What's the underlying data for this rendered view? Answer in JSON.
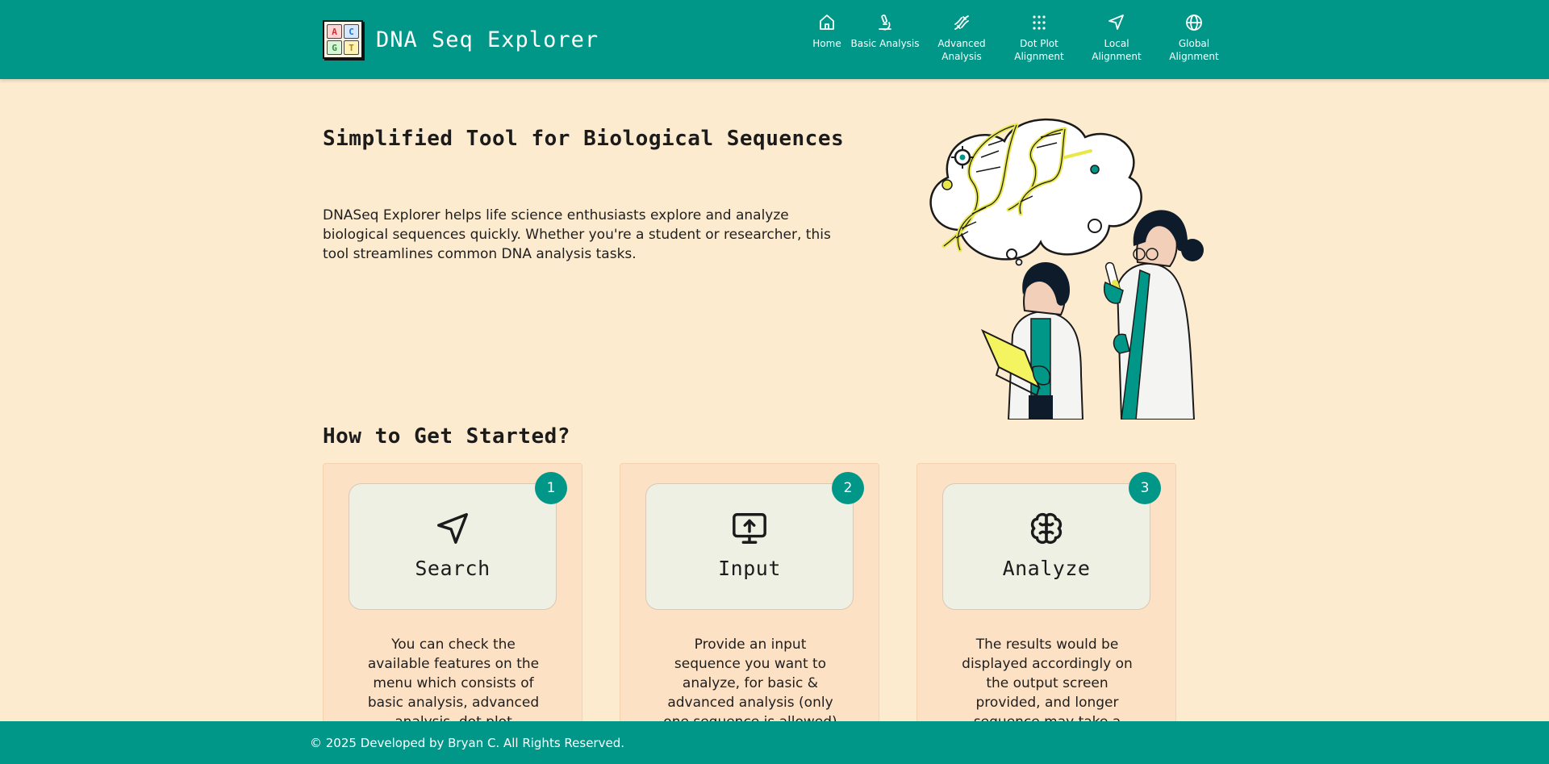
{
  "brand": {
    "title": "DNA Seq Explorer",
    "logo_letters": [
      "A",
      "C",
      "G",
      "T"
    ],
    "logo_colors": [
      "#d32f2f",
      "#1976d2",
      "#388e3c",
      "#f9a825"
    ]
  },
  "nav": {
    "items": [
      {
        "label": "Home",
        "icon": "home-icon"
      },
      {
        "label": "Basic Analysis",
        "icon": "microscope-icon"
      },
      {
        "label": "Advanced\nAnalysis",
        "icon": "dna-icon"
      },
      {
        "label": "Dot Plot\nAlignment",
        "icon": "dot-grid-icon"
      },
      {
        "label": "Local\nAlignment",
        "icon": "navigation-icon"
      },
      {
        "label": "Global\nAlignment",
        "icon": "globe-icon"
      }
    ]
  },
  "hero": {
    "title": "Simplified Tool for Biological Sequences",
    "text": "DNASeq Explorer helps life science enthusiasts explore and analyze biological sequences quickly. Whether you're a student or researcher, this tool streamlines common DNA analysis tasks."
  },
  "getting_started": {
    "title": "How to Get Started?",
    "cards": [
      {
        "number": "1",
        "title": "Search",
        "icon": "navigation-icon",
        "text": "You can check the available features on the menu which consists of basic analysis, advanced analysis, dot plot"
      },
      {
        "number": "2",
        "title": "Input",
        "icon": "upload-monitor-icon",
        "text": "Provide an input sequence you want to analyze, for basic & advanced analysis (only one sequence is allowed) the other features"
      },
      {
        "number": "3",
        "title": "Analyze",
        "icon": "brain-icon",
        "text": "The results would be displayed accordingly on the output screen provided, and longer sequence may take a longer time to"
      }
    ]
  },
  "footer": {
    "text": "© 2025 Developed by Bryan C. All Rights Reserved."
  },
  "colors": {
    "primary": "#009688",
    "background": "#fdebd0",
    "card": "#fde1c5",
    "card_inner": "#eef0e3"
  }
}
